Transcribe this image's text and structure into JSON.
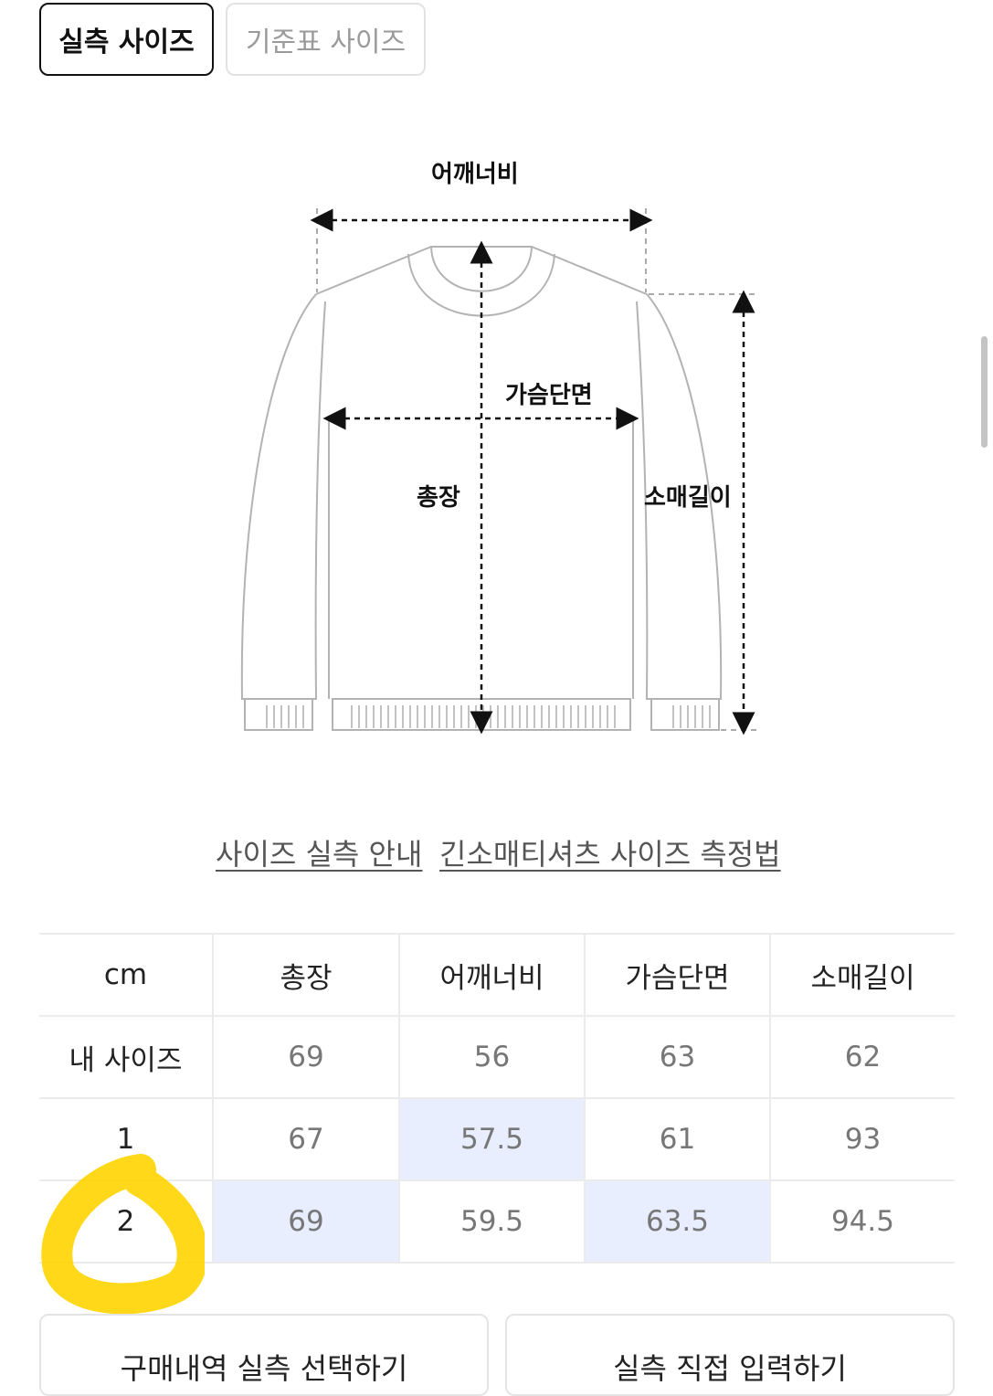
{
  "tabs": {
    "active": "실측 사이즈",
    "inactive": "기준표 사이즈"
  },
  "diagram": {
    "shoulder": "어깨너비",
    "chest": "가슴단면",
    "length": "총장",
    "sleeve": "소매길이"
  },
  "links": {
    "guide": "사이즈 실측 안내",
    "measure": "긴소매티셔츠 사이즈 측정법"
  },
  "table": {
    "headers": [
      "cm",
      "총장",
      "어깨너비",
      "가슴단면",
      "소매길이"
    ],
    "rows": [
      {
        "label": "내 사이즈",
        "values": [
          "69",
          "56",
          "63",
          "62"
        ]
      },
      {
        "label": "1",
        "values": [
          "67",
          "57.5",
          "61",
          "93"
        ]
      },
      {
        "label": "2",
        "values": [
          "69",
          "59.5",
          "63.5",
          "94.5"
        ]
      }
    ]
  },
  "buttons": {
    "left": "구매내역 실측 선택하기",
    "right": "실측 직접 입력하기"
  },
  "colors": {
    "highlight_cell": "#e9eeff",
    "marker": "#ffd400"
  }
}
